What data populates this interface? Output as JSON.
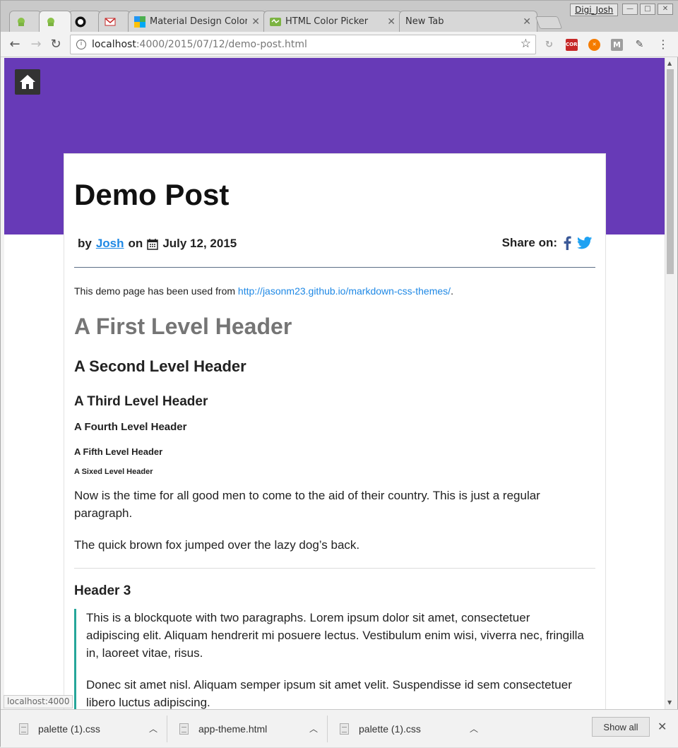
{
  "browser": {
    "profile_name": "Digi_Josh",
    "tabs": [
      {
        "label": "",
        "icon": "android-icon"
      },
      {
        "label": "",
        "icon": "android-icon",
        "active": true
      },
      {
        "label": "",
        "icon": "github-icon"
      },
      {
        "label": "",
        "icon": "gmail-icon"
      },
      {
        "label": "Material Design Color",
        "icon": "material-palette-icon"
      },
      {
        "label": "HTML Color Picker",
        "icon": "color-picker-icon"
      },
      {
        "label": "New Tab",
        "icon": ""
      }
    ],
    "url": {
      "host": "localhost",
      "path": ":4000/2015/07/12/demo-post.html"
    },
    "extensions": [
      "link-extension-icon",
      "cors-extension-icon",
      "orange-extension-icon",
      "m-extension-icon",
      "eyedropper-extension-icon"
    ],
    "status_link": "localhost:4000"
  },
  "page": {
    "title": "Demo Post",
    "meta": {
      "by": "by",
      "author": "Josh",
      "on": "on",
      "date": "July 12, 2015"
    },
    "share_label": "Share on:",
    "intro_text": "This demo page has been used from ",
    "intro_link": "http://jasonm23.github.io/markdown-css-themes/",
    "intro_end": ".",
    "h1": "A First Level Header",
    "h2": "A Second Level Header",
    "h3": "A Third Level Header",
    "h4": "A Fourth Level Header",
    "h5": "A Fifth Level Header",
    "h6": "A Sixed Level Header",
    "para1": "Now is the time for all good men to come to the aid of their country. This is just a regular paragraph.",
    "para2": "The quick brown fox jumped over the lazy dog’s back.",
    "header3": "Header 3",
    "quote1": "This is a blockquote with two paragraphs. Lorem ipsum dolor sit amet, consectetuer adipiscing elit. Aliquam hendrerit mi posuere lectus. Vestibulum enim wisi, viverra nec, fringilla in, laoreet vitae, risus.",
    "quote2": "Donec sit amet nisl. Aliquam semper ipsum sit amet velit. Suspendisse id sem consectetuer libero luctus adipiscing."
  },
  "downloads": {
    "items": [
      "palette (1).css",
      "app-theme.html",
      "palette (1).css"
    ],
    "show_all": "Show all"
  },
  "colors": {
    "hero": "#673ab7",
    "link": "#1e88e5",
    "quote_border": "#26a69a"
  }
}
